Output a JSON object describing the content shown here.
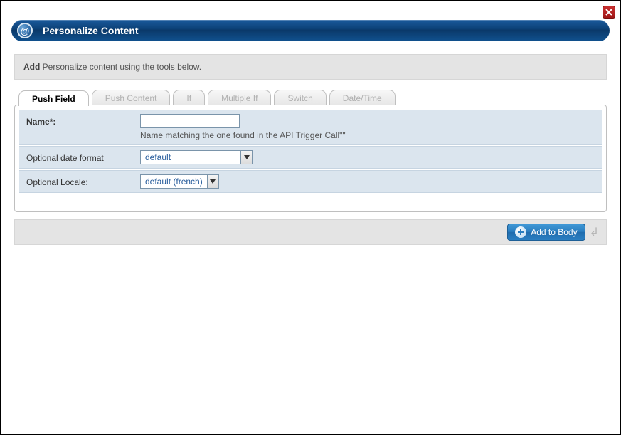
{
  "header": {
    "title": "Personalize Content",
    "icon_glyph": "@"
  },
  "instruction": {
    "bold": "Add",
    "text": " Personalize content using the tools below."
  },
  "tabs": [
    {
      "label": "Push Field",
      "active": true
    },
    {
      "label": "Push Content",
      "active": false
    },
    {
      "label": "If",
      "active": false
    },
    {
      "label": "Multiple If",
      "active": false
    },
    {
      "label": "Switch",
      "active": false
    },
    {
      "label": "Date/Time",
      "active": false
    }
  ],
  "form": {
    "name": {
      "label": "Name*:",
      "value": "",
      "hint": "Name matching the one found in the API Trigger Call\"\""
    },
    "date_format": {
      "label": "Optional date format",
      "value": "default"
    },
    "locale": {
      "label": "Optional Locale:",
      "value": "default (french)"
    }
  },
  "actions": {
    "add_to_body": "Add to Body"
  }
}
